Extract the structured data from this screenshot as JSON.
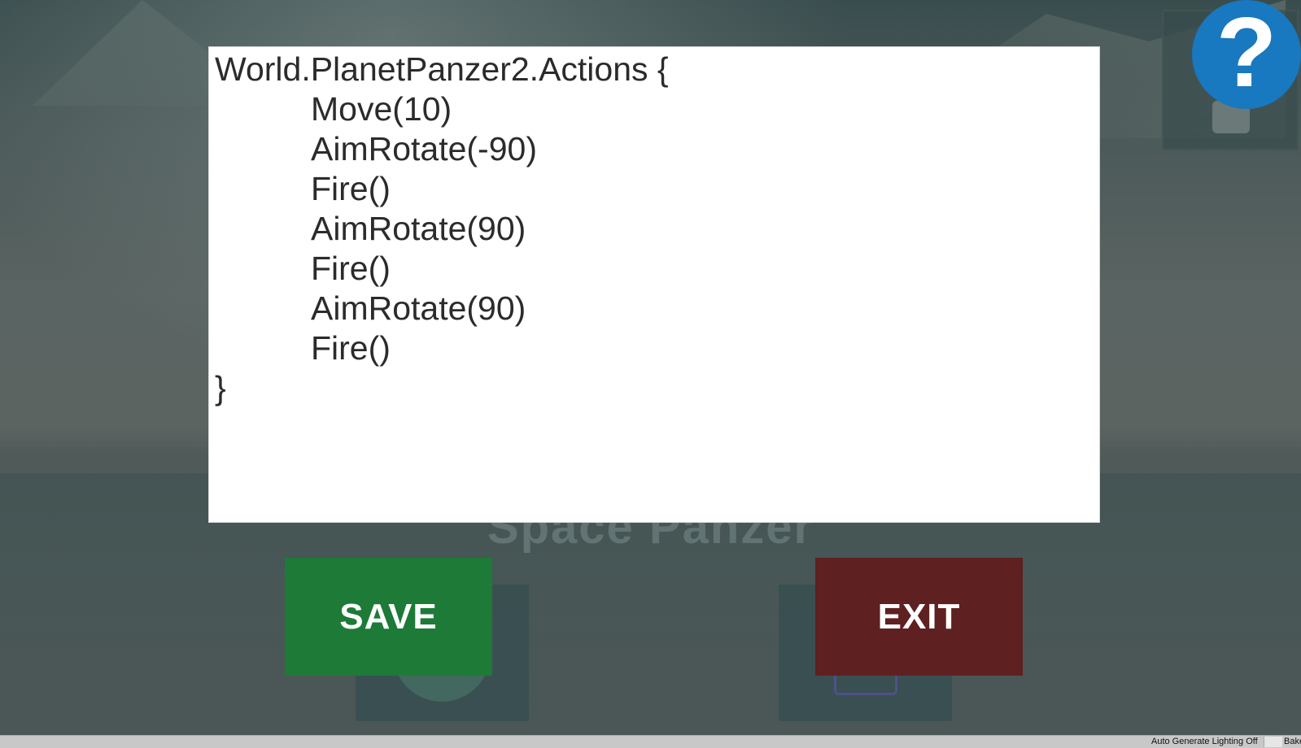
{
  "background": {
    "game_title": "Space Panzer"
  },
  "editor": {
    "lines": [
      {
        "text": "World.PlanetPanzer2.Actions {",
        "indent": false
      },
      {
        "text": "Move(10)",
        "indent": true
      },
      {
        "text": "AimRotate(-90)",
        "indent": true
      },
      {
        "text": "Fire()",
        "indent": true
      },
      {
        "text": "AimRotate(90)",
        "indent": true
      },
      {
        "text": "Fire()",
        "indent": true
      },
      {
        "text": "AimRotate(90)",
        "indent": true
      },
      {
        "text": "Fire()",
        "indent": true
      },
      {
        "text": "}",
        "indent": false
      }
    ]
  },
  "buttons": {
    "save_label": "SAVE",
    "exit_label": "EXIT",
    "save_color": "#1d7a37",
    "exit_color": "#5e2020"
  },
  "help": {
    "label": "?",
    "color": "#1878c0"
  },
  "statusbar": {
    "lighting": "Auto Generate Lighting Off",
    "bake": "Bake"
  }
}
